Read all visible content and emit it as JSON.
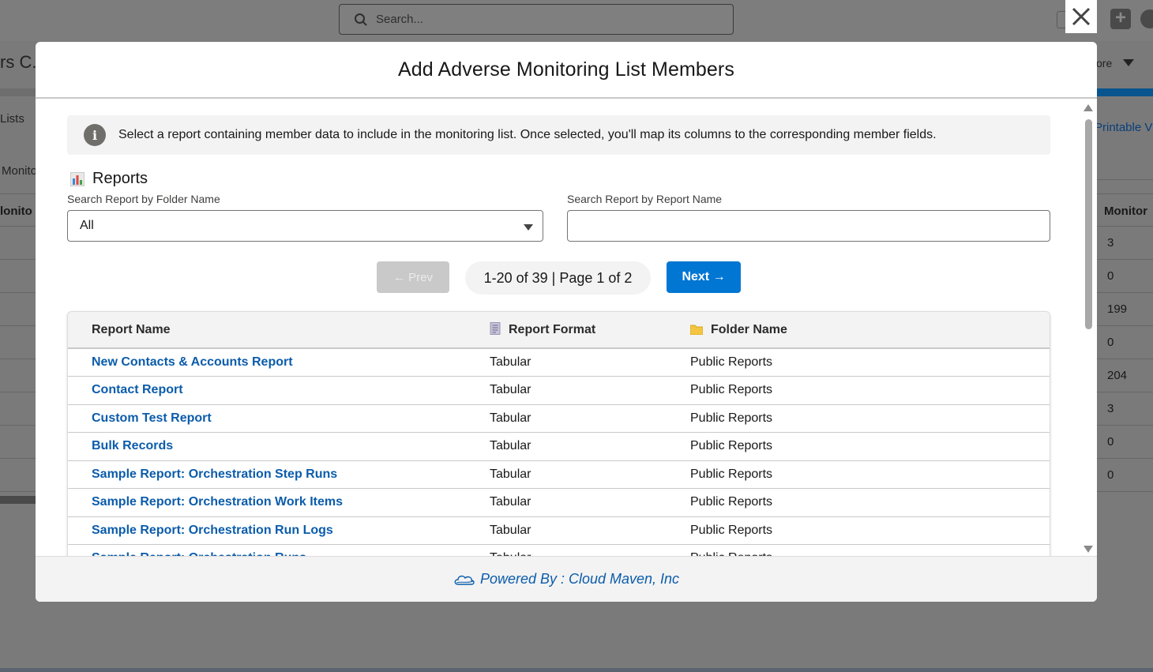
{
  "background": {
    "search_placeholder": "Search...",
    "title": "rs C...",
    "more": "ore",
    "lists": "Lists",
    "monito": "Monito",
    "left_col_header": "lonito",
    "printable": "Printable V",
    "right_col_header": "Monitor",
    "right_col_values": [
      "3",
      "0",
      "199",
      "0",
      "204",
      "3",
      "0",
      "0"
    ]
  },
  "modal": {
    "title": "Add Adverse Monitoring List Members",
    "info_text": "Select a report containing member data to include in the monitoring list. Once selected, you'll map its columns to the corresponding member fields.",
    "section_title": "Reports",
    "folder_label": "Search Report by Folder Name",
    "folder_value": "All",
    "report_label": "Search Report by Report Name",
    "report_value": "",
    "prev_label": "← Prev",
    "page_info": "1-20 of 39 | Page 1 of 2",
    "next_label": "Next →",
    "footer_text": "Powered By : Cloud Maven, Inc"
  },
  "table": {
    "headers": [
      "Report Name",
      "Report Format",
      "Folder Name"
    ],
    "rows": [
      {
        "name": "New Contacts & Accounts Report",
        "format": "Tabular",
        "folder": "Public Reports"
      },
      {
        "name": "Contact Report",
        "format": "Tabular",
        "folder": "Public Reports"
      },
      {
        "name": "Custom Test Report",
        "format": "Tabular",
        "folder": "Public Reports"
      },
      {
        "name": "Bulk Records",
        "format": "Tabular",
        "folder": "Public Reports"
      },
      {
        "name": "Sample Report: Orchestration Step Runs",
        "format": "Tabular",
        "folder": "Public Reports"
      },
      {
        "name": "Sample Report: Orchestration Work Items",
        "format": "Tabular",
        "folder": "Public Reports"
      },
      {
        "name": "Sample Report: Orchestration Run Logs",
        "format": "Tabular",
        "folder": "Public Reports"
      },
      {
        "name": "Sample Report: Orchestration Runs",
        "format": "Tabular",
        "folder": "Public Reports"
      }
    ]
  },
  "colors": {
    "link": "#0b5cab",
    "primary_button": "#0176d3",
    "disabled_button": "#c9c9c9"
  }
}
